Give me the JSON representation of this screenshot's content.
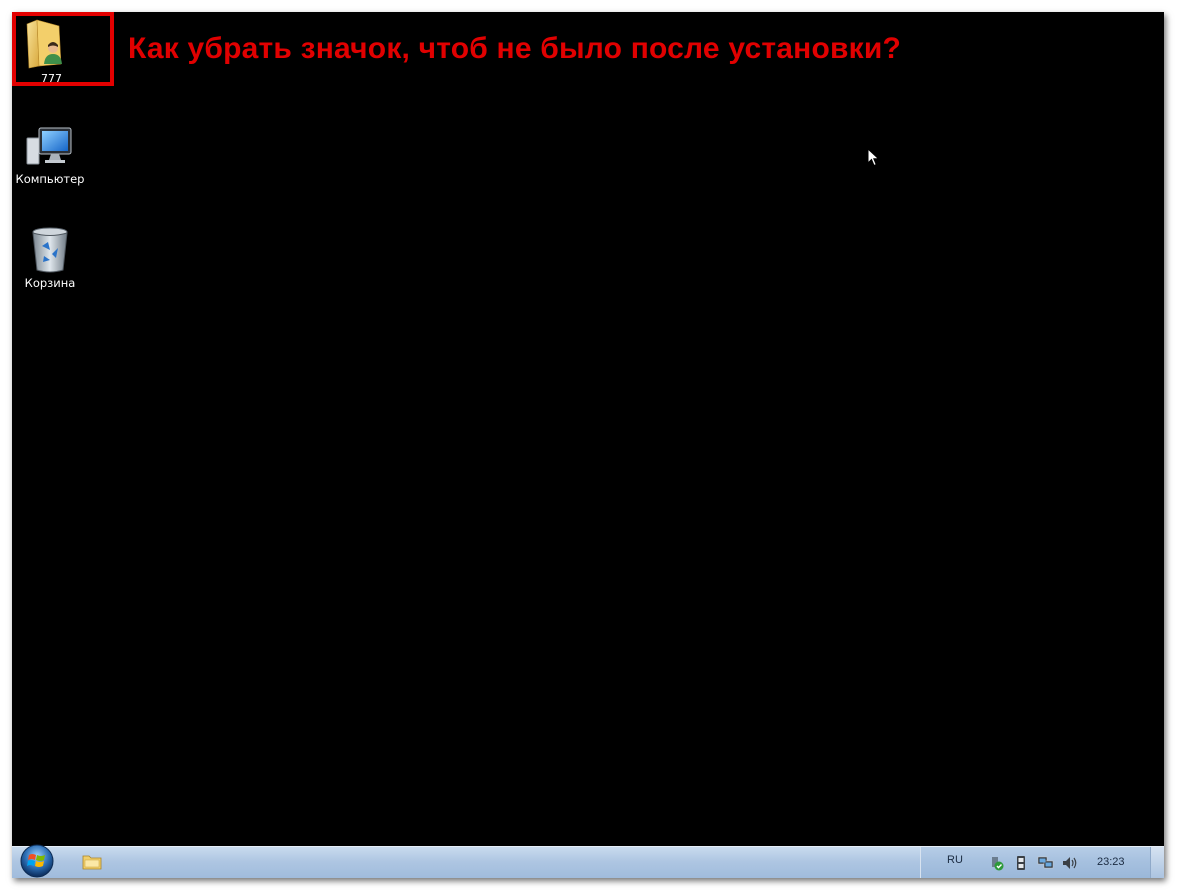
{
  "annotation": {
    "question": "Как убрать значок, чтоб не было после установки?",
    "highlight_color": "#e30000"
  },
  "desktop": {
    "background": "#000000",
    "icons": [
      {
        "label": "777",
        "icon": "user-folder-icon"
      },
      {
        "label": "Компьютер",
        "icon": "computer-icon"
      },
      {
        "label": "Корзина",
        "icon": "recycle-bin-icon"
      }
    ]
  },
  "taskbar": {
    "start_icon": "windows-orb-icon",
    "pinned": [
      {
        "icon": "windows-explorer-icon"
      }
    ],
    "tray": {
      "language": "RU",
      "icons": [
        "safely-remove-hardware-icon",
        "power-icon",
        "network-icon",
        "volume-icon"
      ],
      "time": "23:23"
    }
  }
}
